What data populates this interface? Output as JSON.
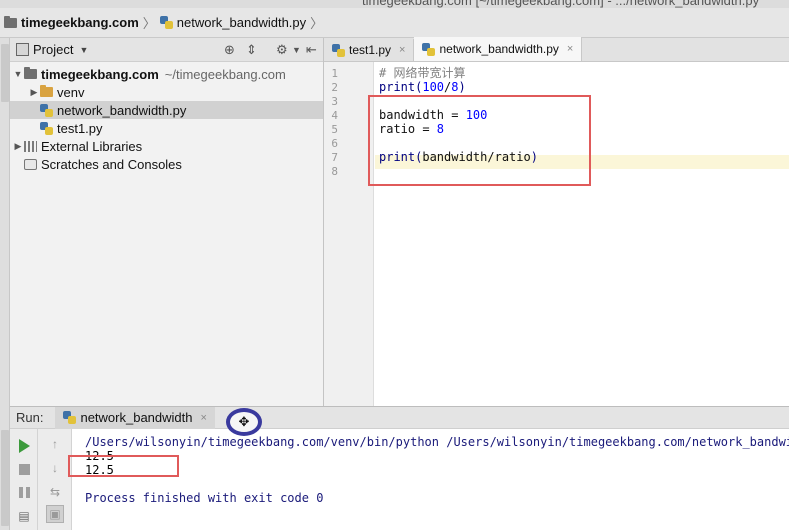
{
  "window": {
    "title_partial": "timegeekbang.com [~/timegeekbang.com] - .../network_bandwidth.py"
  },
  "breadcrumb": {
    "project": "timegeekbang.com",
    "file": "network_bandwidth.py"
  },
  "project_panel": {
    "title": "Project",
    "tree": [
      {
        "label": "timegeekbang.com",
        "path": "~/timegeekbang.com"
      },
      {
        "label": "venv"
      },
      {
        "label": "network_bandwidth.py"
      },
      {
        "label": "test1.py"
      },
      {
        "label": "External Libraries"
      },
      {
        "label": "Scratches and Consoles"
      }
    ]
  },
  "editor": {
    "tabs": [
      {
        "label": "test1.py"
      },
      {
        "label": "network_bandwidth.py"
      }
    ],
    "line_numbers": [
      "1",
      "2",
      "3",
      "4",
      "5",
      "6",
      "7",
      "8"
    ],
    "code": {
      "l1": "# 网络带宽计算",
      "l2_func": "print(",
      "l2_num1": "100",
      "l2_op": "/",
      "l2_num2": "8",
      "l2_end": ")",
      "l4_name": "bandwidth = ",
      "l4_num": "100",
      "l5_name": "ratio = ",
      "l5_num": "8",
      "l7_func": "print(",
      "l7_args": "bandwidth/ratio",
      "l7_end": ")"
    }
  },
  "run_panel": {
    "label": "Run:",
    "tab": "network_bandwidth",
    "console": [
      "/Users/wilsonyin/timegeekbang.com/venv/bin/python /Users/wilsonyin/timegeekbang.com/network_bandwidth",
      "12.5",
      "12.5",
      "",
      "Process finished with exit code 0"
    ]
  },
  "colors": {
    "annotation_box": "#e05a5a",
    "keyword_number": "#0000ff",
    "builtin_func": "#000080",
    "comment": "#808080"
  }
}
